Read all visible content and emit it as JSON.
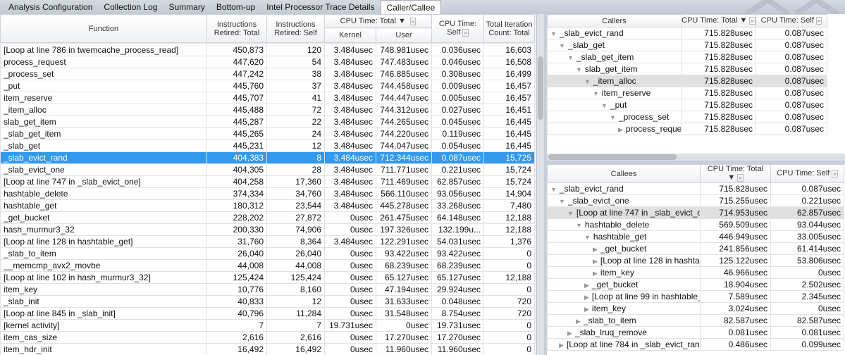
{
  "tabs": [
    "Analysis Configuration",
    "Collection Log",
    "Summary",
    "Bottom-up",
    "Intel Processor Trace Details",
    "Caller/Callee"
  ],
  "active_tab": 5,
  "main": {
    "headers": {
      "function": "Function",
      "instr_total": "Instructions Retired: Total",
      "instr_self": "Instructions Retired: Self",
      "cpu_total": "CPU Time: Total ▼",
      "kernel": "Kernel",
      "user": "User",
      "cpu_self": "CPU Time: Self",
      "iter": "Total Iteration Count: Total",
      "collapse": "«",
      "expand": "»"
    },
    "selected_row": 10,
    "rows": [
      [
        "[Loop at line 786 in twemcache_process_read]",
        "450,873",
        "120",
        "3.484usec",
        "748.981usec",
        "0.036usec",
        "16,603"
      ],
      [
        "process_request",
        "447,620",
        "54",
        "3.484usec",
        "747.483usec",
        "0.046usec",
        "16,508"
      ],
      [
        "_process_set",
        "447,242",
        "38",
        "3.484usec",
        "746.885usec",
        "0.308usec",
        "16,499"
      ],
      [
        "_put",
        "445,760",
        "37",
        "3.484usec",
        "744.458usec",
        "0.009usec",
        "16,457"
      ],
      [
        "item_reserve",
        "445,707",
        "41",
        "3.484usec",
        "744.447usec",
        "0.005usec",
        "16,457"
      ],
      [
        "_item_alloc",
        "445,488",
        "72",
        "3.484usec",
        "744.312usec",
        "0.027usec",
        "16,451"
      ],
      [
        "slab_get_item",
        "445,287",
        "22",
        "3.484usec",
        "744.265usec",
        "0.045usec",
        "16,445"
      ],
      [
        "_slab_get_item",
        "445,265",
        "24",
        "3.484usec",
        "744.220usec",
        "0.119usec",
        "16,445"
      ],
      [
        "_slab_get",
        "445,231",
        "12",
        "3.484usec",
        "744.047usec",
        "0.054usec",
        "16,445"
      ],
      [
        "_slab_evict_rand",
        "404,383",
        "8",
        "3.484usec",
        "712.344usec",
        "0.087usec",
        "15,725"
      ],
      [
        "_slab_evict_one",
        "404,305",
        "28",
        "3.484usec",
        "711.771usec",
        "0.221usec",
        "15,724"
      ],
      [
        "[Loop at line 747 in _slab_evict_one]",
        "404,258",
        "17,360",
        "3.484usec",
        "711.469usec",
        "62.857usec",
        "15,724"
      ],
      [
        "hashtable_delete",
        "374,334",
        "34,760",
        "3.484usec",
        "566.110usec",
        "93.056usec",
        "14,904"
      ],
      [
        "hashtable_get",
        "180,312",
        "23,544",
        "3.484usec",
        "445.278usec",
        "33.268usec",
        "7,480"
      ],
      [
        "_get_bucket",
        "228,202",
        "27,872",
        "0usec",
        "261.475usec",
        "64.148usec",
        "12,188"
      ],
      [
        "hash_murmur3_32",
        "200,330",
        "74,906",
        "0usec",
        "197.326usec",
        "132.199u...",
        "12,188"
      ],
      [
        "[Loop at line 128 in hashtable_get]",
        "31,760",
        "8,364",
        "3.484usec",
        "122.291usec",
        "54.031usec",
        "1,376"
      ],
      [
        "_slab_to_item",
        "26,040",
        "26,040",
        "0usec",
        "93.422usec",
        "93.422usec",
        "0"
      ],
      [
        "__memcmp_avx2_movbe",
        "44,008",
        "44,008",
        "0usec",
        "68.239usec",
        "68.239usec",
        "0"
      ],
      [
        "[Loop at line 102 in hash_murmur3_32]",
        "125,424",
        "125,424",
        "0usec",
        "65.127usec",
        "65.127usec",
        "12,188"
      ],
      [
        "item_key",
        "10,776",
        "8,160",
        "0usec",
        "47.194usec",
        "29.924usec",
        "0"
      ],
      [
        "_slab_init",
        "40,833",
        "12",
        "0usec",
        "31.633usec",
        "0.048usec",
        "720"
      ],
      [
        "[Loop at line 845 in _slab_init]",
        "40,796",
        "11,284",
        "0usec",
        "31.548usec",
        "8.754usec",
        "720"
      ],
      [
        "[kernel activity]",
        "7",
        "7",
        "19.731usec",
        "0usec",
        "19.731usec",
        "0"
      ],
      [
        "item_cas_size",
        "2,616",
        "2,616",
        "0usec",
        "17.270usec",
        "17.270usec",
        "0"
      ],
      [
        "item_hdr_init",
        "16,492",
        "16,492",
        "0usec",
        "11.960usec",
        "11.960usec",
        "0"
      ]
    ]
  },
  "callers": {
    "headers": {
      "name": "Callers",
      "total": "CPU Time: Total ▼",
      "self": "CPU Time: Self"
    },
    "highlighted_row": 4,
    "rows": [
      {
        "name": "_slab_evict_rand",
        "depth": 0,
        "icon": "expanded",
        "total": "715.828usec",
        "self": "0.087usec"
      },
      {
        "name": "_slab_get",
        "depth": 1,
        "icon": "expanded",
        "total": "715.828usec",
        "self": "0.087usec"
      },
      {
        "name": "_slab_get_item",
        "depth": 2,
        "icon": "expanded",
        "total": "715.828usec",
        "self": "0.087usec"
      },
      {
        "name": "slab_get_item",
        "depth": 3,
        "icon": "expanded",
        "total": "715.828usec",
        "self": "0.087usec"
      },
      {
        "name": "_item_alloc",
        "depth": 4,
        "icon": "expanded",
        "total": "715.828usec",
        "self": "0.087usec"
      },
      {
        "name": "item_reserve",
        "depth": 5,
        "icon": "expanded",
        "total": "715.828usec",
        "self": "0.087usec"
      },
      {
        "name": "_put",
        "depth": 6,
        "icon": "expanded",
        "total": "715.828usec",
        "self": "0.087usec"
      },
      {
        "name": "_process_set",
        "depth": 7,
        "icon": "expanded",
        "total": "715.828usec",
        "self": "0.087usec"
      },
      {
        "name": "process_reques",
        "depth": 8,
        "icon": "collapsed",
        "total": "715.828usec",
        "self": "0.087usec"
      }
    ]
  },
  "callees": {
    "headers": {
      "name": "Callees",
      "total": "CPU Time: Total ▼",
      "self": "CPU Time: Self"
    },
    "highlighted_row": 2,
    "rows": [
      {
        "name": "_slab_evict_rand",
        "depth": 0,
        "icon": "expanded",
        "total": "715.828usec",
        "self": "0.087usec"
      },
      {
        "name": "_slab_evict_one",
        "depth": 1,
        "icon": "expanded",
        "total": "715.255usec",
        "self": "0.221usec"
      },
      {
        "name": "[Loop at line 747 in _slab_evict_or",
        "depth": 2,
        "icon": "expanded",
        "total": "714.953usec",
        "self": "62.857usec"
      },
      {
        "name": "hashtable_delete",
        "depth": 3,
        "icon": "expanded",
        "total": "569.509usec",
        "self": "93.044usec"
      },
      {
        "name": "hashtable_get",
        "depth": 4,
        "icon": "expanded",
        "total": "446.949usec",
        "self": "33.005usec"
      },
      {
        "name": "_get_bucket",
        "depth": 5,
        "icon": "collapsed",
        "total": "241.856usec",
        "self": "61.414usec"
      },
      {
        "name": "[Loop at line 128 in hashtab",
        "depth": 5,
        "icon": "collapsed",
        "total": "125.122usec",
        "self": "53.806usec"
      },
      {
        "name": "item_key",
        "depth": 5,
        "icon": "collapsed",
        "total": "46.966usec",
        "self": "0usec"
      },
      {
        "name": "_get_bucket",
        "depth": 4,
        "icon": "collapsed",
        "total": "18.904usec",
        "self": "2.502usec"
      },
      {
        "name": "[Loop at line 99 in hashtable_",
        "depth": 4,
        "icon": "collapsed",
        "total": "7.589usec",
        "self": "2.345usec"
      },
      {
        "name": "item_key",
        "depth": 4,
        "icon": "collapsed",
        "total": "3.024usec",
        "self": "0usec"
      },
      {
        "name": "_slab_to_item",
        "depth": 3,
        "icon": "collapsed",
        "total": "82.587usec",
        "self": "82.587usec"
      },
      {
        "name": "_slab_lruq_remove",
        "depth": 2,
        "icon": "collapsed",
        "total": "0.081usec",
        "self": "0.081usec"
      },
      {
        "name": "[Loop at line 784 in _slab_evict_ranc",
        "depth": 1,
        "icon": "collapsed",
        "total": "0.486usec",
        "self": "0.099usec"
      }
    ]
  }
}
